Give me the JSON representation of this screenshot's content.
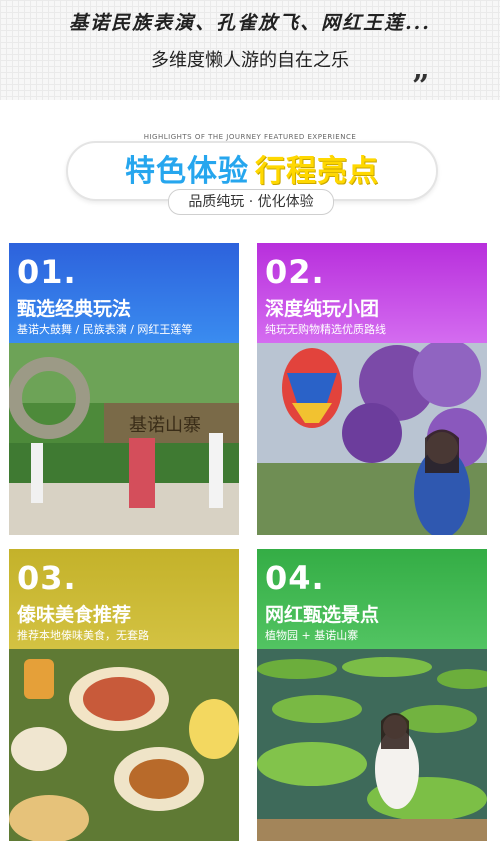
{
  "header": {
    "headline": "基诺民族表演、孔雀放飞、网红王莲...",
    "subline": "多维度懒人游的自在之乐",
    "quote_mark": "”"
  },
  "banner": {
    "small_caption": "HIGHLIGHTS OF THE JOURNEY FEATURED EXPERIENCE",
    "title_part1": "特色体验",
    "title_part2": "行程亮点",
    "subtitle": "品质纯玩 · 优化体验"
  },
  "cards": [
    {
      "number": "01.",
      "title": "甄选经典玩法",
      "desc": "基诺大鼓舞 / 民族表演 / 网红王莲等",
      "color": "#2f6fe0",
      "photo_text": "基诺山寨"
    },
    {
      "number": "02.",
      "title": "深度纯玩小团",
      "desc": "纯玩无购物精选优质路线",
      "color": "#c13ce2"
    },
    {
      "number": "03.",
      "title": "傣味美食推荐",
      "desc": "推荐本地傣味美食，无套路",
      "color": "#c8b72e"
    },
    {
      "number": "04.",
      "title": "网红甄选景点",
      "desc": "植物园 + 基诺山寨",
      "color": "#37b449"
    }
  ]
}
